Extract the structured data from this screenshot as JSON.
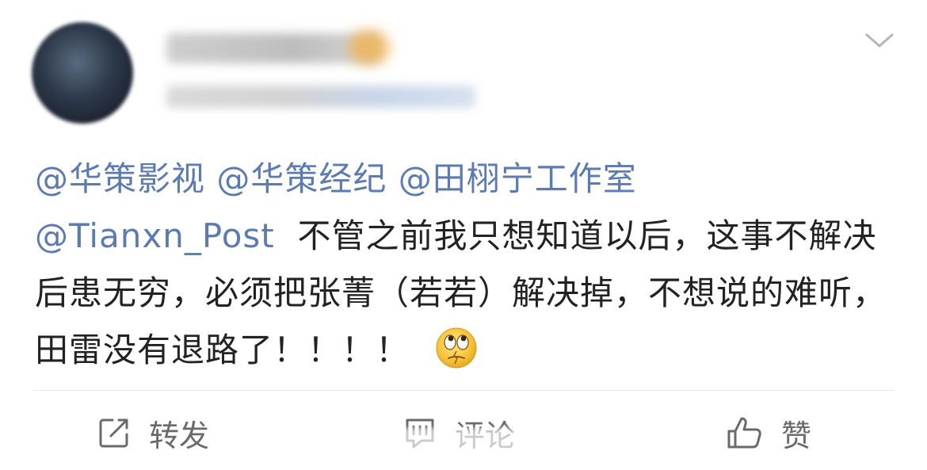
{
  "post": {
    "content": {
      "mention1": "@华策影视",
      "mention2": "@华策经纪",
      "mention3": "@田栩宁工作室",
      "mention4": "@Tianxn_Post",
      "text": "不管之前我只想知道以后，这事不解决后患无穷，必须把张菁（若若）解决掉，不想说的难听，田雷没有退路了！！！！"
    },
    "emoji": "rolling-eyes-emoji"
  },
  "actions": {
    "repost_label": "转发",
    "comment_label": "评论",
    "like_label": "赞"
  },
  "colors": {
    "mention": "#5b7bb1",
    "text": "#222222",
    "action": "#6a6a6a"
  },
  "icons": [
    "avatar",
    "chevron-down-icon",
    "repost-icon",
    "comment-icon",
    "like-icon",
    "rolling-eyes-emoji"
  ]
}
